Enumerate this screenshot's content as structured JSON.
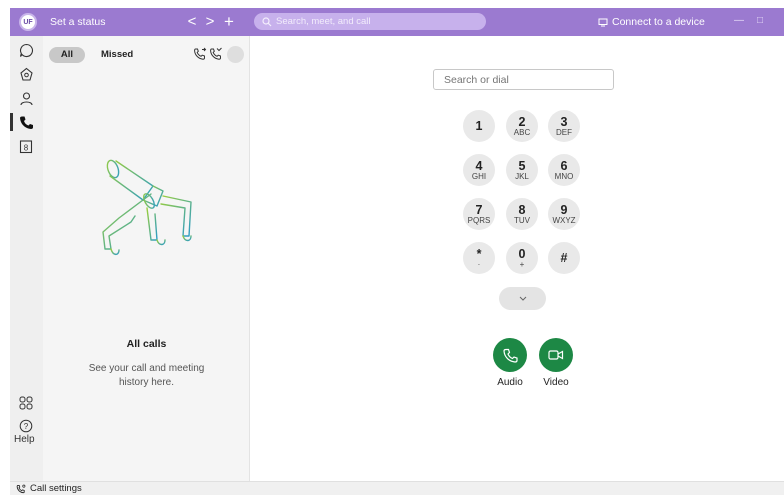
{
  "titlebar": {
    "avatar_initials": "UF",
    "status_text": "Set a status",
    "back_glyph": "<",
    "forward_glyph": ">",
    "new_glyph": "+",
    "search_placeholder": "Search, meet, and call",
    "connect_label": "Connect to a device",
    "accent_color": "#9b7ad0"
  },
  "rail": {
    "items": [
      {
        "name": "messaging",
        "icon": "chat-icon"
      },
      {
        "name": "teams",
        "icon": "teams-icon"
      },
      {
        "name": "contacts",
        "icon": "person-icon"
      },
      {
        "name": "calling",
        "icon": "phone-icon",
        "active": true
      },
      {
        "name": "meetings",
        "icon": "calendar-icon"
      }
    ],
    "apps_icon": "apps-icon",
    "help_label": "Help"
  },
  "panel": {
    "tab_all": "All",
    "tab_missed": "Missed",
    "empty_title": "All calls",
    "empty_line1": "See your call and meeting",
    "empty_line2": "history here."
  },
  "main": {
    "dial_placeholder": "Search or dial",
    "keys": [
      {
        "digit": "1",
        "letters": ""
      },
      {
        "digit": "2",
        "letters": "ABC"
      },
      {
        "digit": "3",
        "letters": "DEF"
      },
      {
        "digit": "4",
        "letters": "GHI"
      },
      {
        "digit": "5",
        "letters": "JKL"
      },
      {
        "digit": "6",
        "letters": "MNO"
      },
      {
        "digit": "7",
        "letters": "PQRS"
      },
      {
        "digit": "8",
        "letters": "TUV"
      },
      {
        "digit": "9",
        "letters": "WXYZ"
      },
      {
        "digit": "*",
        "letters": "·"
      },
      {
        "digit": "0",
        "letters": "+"
      },
      {
        "digit": "#",
        "letters": ""
      }
    ],
    "audio_label": "Audio",
    "video_label": "Video",
    "call_color": "#1d8845"
  },
  "statusbar": {
    "call_settings_label": "Call settings"
  }
}
